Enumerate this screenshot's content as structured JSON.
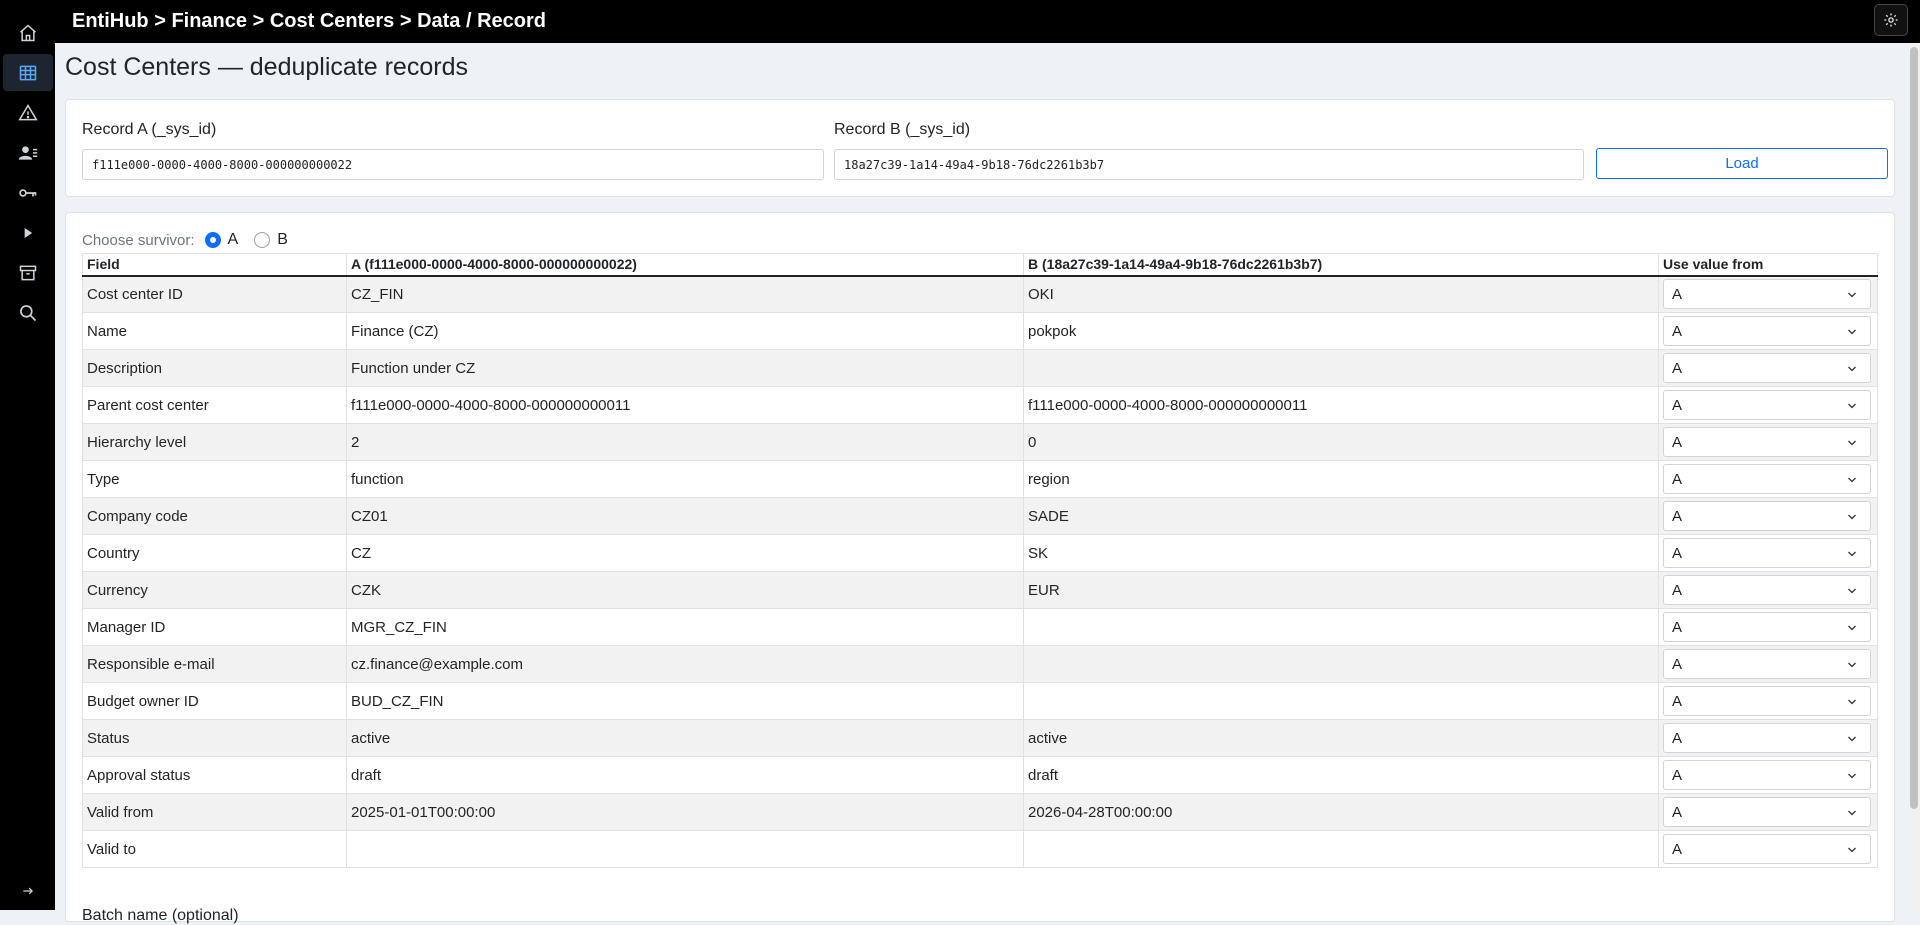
{
  "app": {
    "breadcrumb": "EntiHub > Finance > Cost Centers > Data / Record"
  },
  "sidebar": {
    "items": [
      {
        "name": "home-icon"
      },
      {
        "name": "table-icon",
        "active": true
      },
      {
        "name": "warning-icon"
      },
      {
        "name": "users-icon"
      },
      {
        "name": "key-icon"
      },
      {
        "name": "play-icon"
      },
      {
        "name": "archive-icon"
      },
      {
        "name": "search-icon"
      }
    ],
    "expand_icon": "arrow-right-icon"
  },
  "page": {
    "title": "Cost Centers — deduplicate records"
  },
  "records": {
    "a_label": "Record A (_sys_id)",
    "a_value": "f111e000-0000-4000-8000-000000000022",
    "b_label": "Record B (_sys_id)",
    "b_value": "18a27c39-1a14-49a4-9b18-76dc2261b3b7",
    "load_label": "Load"
  },
  "survivor": {
    "label": "Choose survivor:",
    "option_a": "A",
    "option_b": "B",
    "selected": "A"
  },
  "table": {
    "headers": {
      "field": "Field",
      "a": "A (f111e000-0000-4000-8000-000000000022)",
      "b": "B (18a27c39-1a14-49a4-9b18-76dc2261b3b7)",
      "use": "Use value from"
    },
    "rows": [
      {
        "field": "Cost center ID",
        "a": "CZ_FIN",
        "b": "OKI",
        "use": "A"
      },
      {
        "field": "Name",
        "a": "Finance (CZ)",
        "b": "pokpok",
        "use": "A"
      },
      {
        "field": "Description",
        "a": "Function under CZ",
        "b": "",
        "use": "A"
      },
      {
        "field": "Parent cost center",
        "a": "f111e000-0000-4000-8000-000000000011",
        "b": "f111e000-0000-4000-8000-000000000011",
        "use": "A"
      },
      {
        "field": "Hierarchy level",
        "a": "2",
        "b": "0",
        "use": "A"
      },
      {
        "field": "Type",
        "a": "function",
        "b": "region",
        "use": "A"
      },
      {
        "field": "Company code",
        "a": "CZ01",
        "b": "SADE",
        "use": "A"
      },
      {
        "field": "Country",
        "a": "CZ",
        "b": "SK",
        "use": "A"
      },
      {
        "field": "Currency",
        "a": "CZK",
        "b": "EUR",
        "use": "A"
      },
      {
        "field": "Manager ID",
        "a": "MGR_CZ_FIN",
        "b": "",
        "use": "A"
      },
      {
        "field": "Responsible e-mail",
        "a": "cz.finance@example.com",
        "b": "",
        "use": "A"
      },
      {
        "field": "Budget owner ID",
        "a": "BUD_CZ_FIN",
        "b": "",
        "use": "A"
      },
      {
        "field": "Status",
        "a": "active",
        "b": "active",
        "use": "A"
      },
      {
        "field": "Approval status",
        "a": "draft",
        "b": "draft",
        "use": "A"
      },
      {
        "field": "Valid from",
        "a": "2025-01-01T00:00:00",
        "b": "2026-04-28T00:00:00",
        "use": "A"
      },
      {
        "field": "Valid to",
        "a": "",
        "b": "",
        "use": "A"
      }
    ]
  },
  "batch": {
    "label": "Batch name (optional)"
  }
}
